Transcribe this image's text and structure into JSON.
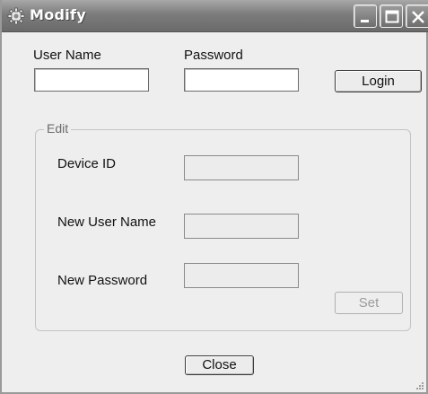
{
  "window": {
    "title": "Modify",
    "title_icon": "gear-icon",
    "controls": [
      "minimize-icon",
      "maximize-icon",
      "close-icon"
    ]
  },
  "login": {
    "username_label": "User Name",
    "username_value": "",
    "password_label": "Password",
    "password_value": "",
    "login_button": "Login"
  },
  "edit_group": {
    "title": "Edit",
    "device_id_label": "Device ID",
    "device_id_value": "",
    "new_username_label": "New User Name",
    "new_username_value": "",
    "new_password_label": "New Password",
    "new_password_value": "",
    "set_button": "Set"
  },
  "footer": {
    "close_button": "Close"
  },
  "colors": {
    "titlebar": "#7c7c7c",
    "window_bg": "#eeeeee",
    "disabled_text": "#9c9c9c"
  }
}
